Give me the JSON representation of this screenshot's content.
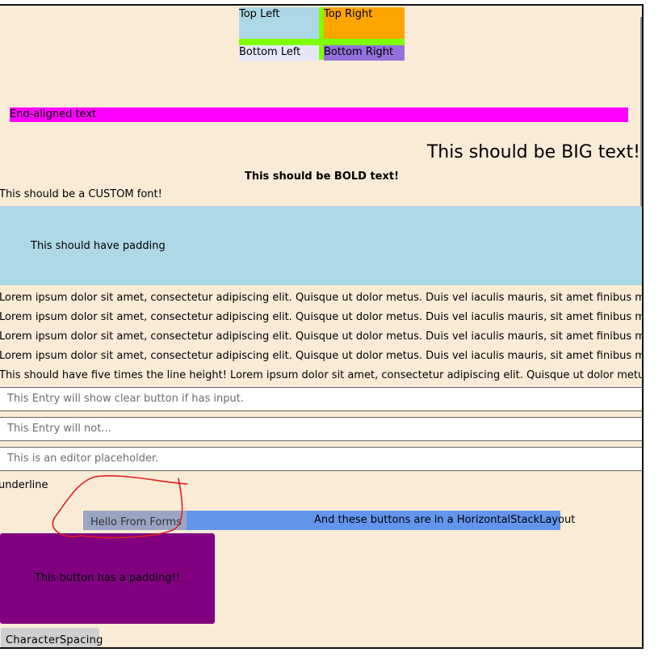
{
  "grid": {
    "top_left": "Top Left",
    "top_right": "Top Right",
    "bottom_left": "Bottom Left",
    "bottom_right": "Bottom Right"
  },
  "labels": {
    "end_aligned": "End-aligned text",
    "big": "This should be BIG text!",
    "bold": "This should be BOLD text!",
    "custom_font": "This should be a CUSTOM font!",
    "padding": "This should have padding",
    "lorem": [
      "Lorem ipsum dolor sit amet, consectetur adipiscing elit. Quisque ut dolor metus. Duis vel iaculis mauris, sit amet finibus mi. Etiam",
      "Lorem ipsum dolor sit amet, consectetur adipiscing elit. Quisque ut dolor metus. Duis vel iaculis mauris, sit amet finibus mi. Etiam",
      "Lorem ipsum dolor sit amet, consectetur adipiscing elit. Quisque ut dolor metus. Duis vel iaculis mauris, sit amet finibus mi. Etiam",
      "Lorem ipsum dolor sit amet, consectetur adipiscing elit. Quisque ut dolor metus. Duis vel iaculis mauris, sit amet finibus mi. Etiam"
    ],
    "line_height": "This should have five times the line height! Lorem ipsum dolor sit amet, consectetur adipiscing elit. Quisque ut dolor metus. Duis vel",
    "underline": "underline"
  },
  "entries": {
    "clear_button": {
      "placeholder": "This Entry will show clear button if has input.",
      "value": ""
    },
    "no_clear": {
      "placeholder": "This Entry will not...",
      "value": ""
    },
    "editor": {
      "placeholder": "This is an editor placeholder.",
      "value": ""
    }
  },
  "buttons": {
    "hello": "Hello From Forms",
    "hstack_label": "And these buttons are in a HorizontalStackLayout",
    "padding_button": "This button has a padding!!",
    "character_spacing": "CharacterSpacing"
  },
  "colors": {
    "page_background": "#faebd7",
    "annotation_scribble": "#e02020"
  }
}
